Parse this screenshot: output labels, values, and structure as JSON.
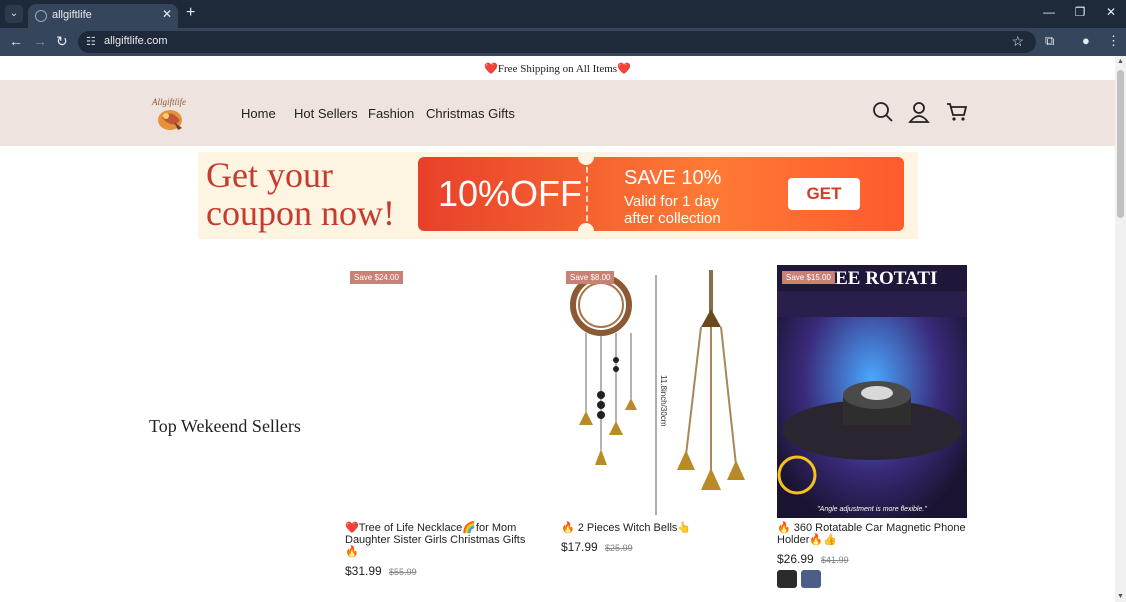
{
  "browser": {
    "tab_title": "allgiftlife",
    "url": "allgiftlife.com"
  },
  "announcement": {
    "text": "Free Shipping on All Items",
    "heart_left": "❤️",
    "heart_right": "❤️"
  },
  "header": {
    "logo_text": "Allgiftlife",
    "nav": [
      "Home",
      "Hot Sellers",
      "Fashion",
      "Christmas Gifts"
    ],
    "icons": [
      "search-icon",
      "account-icon",
      "cart-icon"
    ]
  },
  "banner": {
    "headline_line1": "Get your",
    "headline_line2": "coupon now!",
    "discount": "10%OFF",
    "save_text": "SAVE 10%",
    "valid_line1": "Valid for 1 day",
    "valid_line2": "after collection",
    "cta": "GET"
  },
  "section": {
    "title": "Top Wekeend Sellers"
  },
  "products": [
    {
      "badge": "Save $24.00",
      "title": "❤️Tree of Life Necklace🌈for Mom Daughter Sister Girls Christmas Gifts🔥",
      "price": "$31.99",
      "compare_price": "$55.99"
    },
    {
      "badge": "Save $8.00",
      "title": "🔥 2 Pieces Witch Bells👆",
      "price": "$17.99",
      "compare_price": "$25.99"
    },
    {
      "badge": "Save $15.00",
      "title": "🔥 360 Rotatable Car Magnetic Phone Holder🔥👍",
      "price": "$26.99",
      "compare_price": "$41.99",
      "image_heading": "GREE ROTATI",
      "image_caption": "\"Angle adjustment is more flexible.\""
    }
  ],
  "colors": {
    "header_bg": "#efe3df",
    "badge_bg": "#c98075",
    "banner_red": "#c63b2f"
  }
}
